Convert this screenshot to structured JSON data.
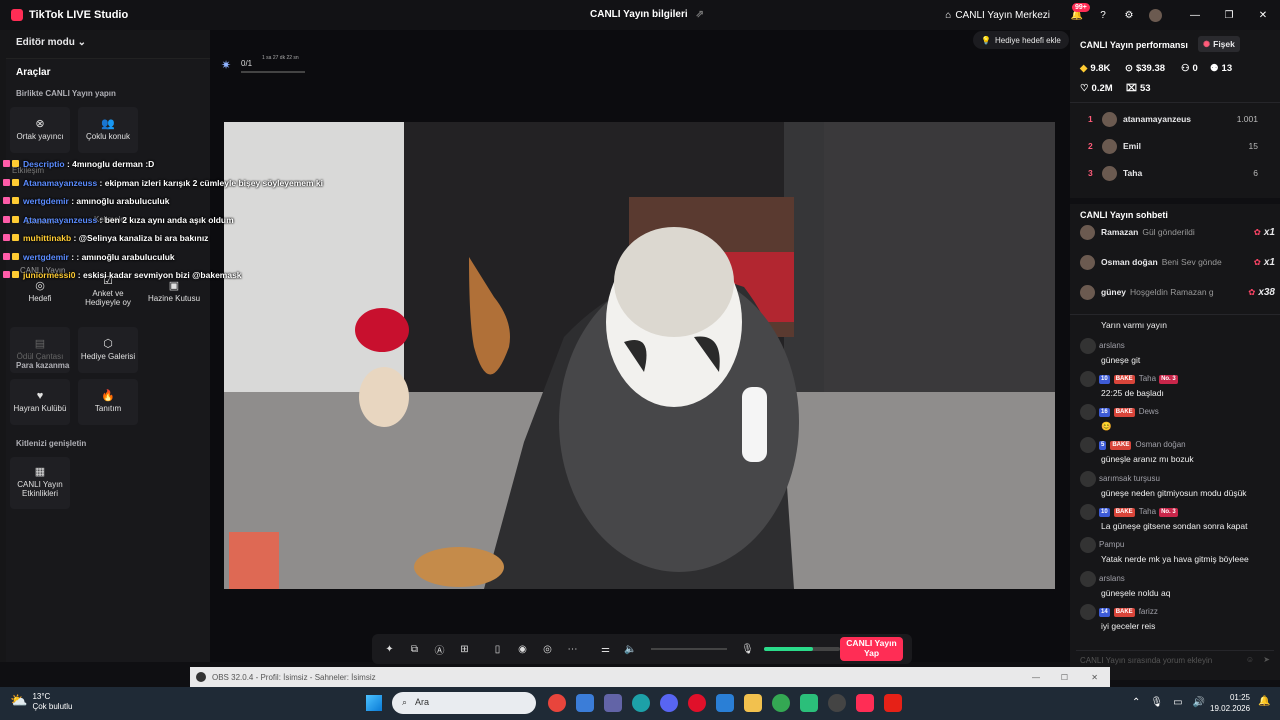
{
  "titlebar": {
    "app_title": "TikTok LIVE Studio",
    "center_title": "CANLI Yayın bilgileri",
    "live_center": "CANLI Yayın Merkezi",
    "notif_badge": "99+"
  },
  "left": {
    "mode": "Editör modu",
    "tools_title": "Araçlar",
    "sec_together": "Birlikte CANLI Yayın yapın",
    "tool_cohost": "Ortak yayıncı",
    "tool_multiguest": "Çoklu konuk",
    "hidden_etkilesim": "Etkileşim",
    "hidden_dilekler": "Dilekleri",
    "hidden_kelimeler": "Kelimeler",
    "hidden_canli": "CANLI Yayın",
    "tool_goal": "Hedefi",
    "tool_poll": "Anket ve Hediyeyle oy",
    "tool_treasure": "Hazine Kutusu",
    "tool_award": "Ödül Çantası",
    "tool_gallery": "Hediye Galerisi",
    "sec_money": "Para kazanma",
    "tool_fanclub": "Hayran Kulübü",
    "tool_promote": "Tanıtım",
    "sec_expand": "Kitlenizi genişletin",
    "tool_events": "CANLI Yayın Etkinlikleri"
  },
  "overlay": [
    {
      "user": "Descriptio",
      "text": " : 4mınoglu derman :D",
      "color": "#5b8cff"
    },
    {
      "user": "Atanamayanzeuss",
      "text": " : ekipman izleri karışık 2 cümleyle bişey söyleyemem ki",
      "color": "#5b8cff"
    },
    {
      "user": "wertgdemir",
      "text": " : amınoğlu arabuluculuk",
      "color": "#5b8cff"
    },
    {
      "user": "Atanamayanzeuss",
      "text": " : ben 2 kıza aynı anda aşık oldum",
      "color": "#5b8cff"
    },
    {
      "user": "muhittinakb",
      "text": " : @Selinya kanaliza bi ara bakınız",
      "color": "#ffcc33"
    },
    {
      "user": "wertgdemir",
      "text": " : : amınoğlu arabuluculuk",
      "color": "#5b8cff"
    },
    {
      "user": "",
      "text": "",
      "color": "#fff"
    },
    {
      "user": "juniormessi0",
      "text": " : eskisi kadar sevmiyon bizi @bakemask",
      "color": "#ffcc33"
    }
  ],
  "stage": {
    "goal_button": "Hediye hedefi ekle",
    "progress_count": "0/1",
    "progress_time": "1 sa 27 dk 22 sn",
    "progress_fraction": 0.0
  },
  "controls": {
    "golive": "CANLI Yayın Yap",
    "mic_level": 0.65
  },
  "right": {
    "perf_title": "CANLI Yayın performansı",
    "fisek": "Fişek",
    "stats": {
      "diamonds": "9.8K",
      "money": "$39.38",
      "viewers": "0",
      "followers": "13",
      "likes": "0.2M",
      "gifts": "53"
    },
    "ranking": [
      {
        "rank": "1",
        "name": "atanamayanzeus",
        "score": "1.001"
      },
      {
        "rank": "2",
        "name": "Emil",
        "score": "15"
      },
      {
        "rank": "3",
        "name": "Taha",
        "score": "6"
      }
    ],
    "chat_title": "CANLI Yayın sohbeti",
    "gifts": [
      {
        "name": "Ramazan",
        "text": "Gül gönderildi",
        "count": "x1"
      },
      {
        "name": "Osman doğan",
        "text": "Beni Sev gönde",
        "count": "x1"
      },
      {
        "name": "güney",
        "text": "Hoşgeldin Ramazan g",
        "count": "x38"
      }
    ],
    "messages": [
      {
        "user": "",
        "level": "",
        "tag": "",
        "extra": "",
        "text": "Yarın varmı yayın"
      },
      {
        "user": "arslans",
        "level": "",
        "tag": "",
        "extra": "",
        "text": "güneşe git"
      },
      {
        "user": "Taha",
        "level": "10",
        "tag": "BAKE",
        "extra": "No. 3",
        "text": "22:25 de başladı"
      },
      {
        "user": "Dews",
        "level": "16",
        "tag": "BAKE",
        "extra": "",
        "text": "😊"
      },
      {
        "user": "Osman doğan",
        "level": "5",
        "tag": "BAKE",
        "extra": "",
        "text": "güneşle aranız mı bozuk"
      },
      {
        "user": "sarımsak turşusu",
        "level": "",
        "tag": "",
        "extra": "",
        "text": "güneşe neden gitmiyosun modu düşük"
      },
      {
        "user": "Taha",
        "level": "10",
        "tag": "BAKE",
        "extra": "No. 3",
        "text": "La güneşe gitsene sondan sonra kapat"
      },
      {
        "user": "Pampu",
        "level": "",
        "tag": "",
        "extra": "",
        "text": "Yatak nerde mk ya hava gitmiş böyleee"
      },
      {
        "user": "arslans",
        "level": "",
        "tag": "",
        "extra": "",
        "text": "güneşele noldu aq"
      },
      {
        "user": "farizz",
        "level": "14",
        "tag": "BAKE",
        "extra": "",
        "text": "iyi geceler reis"
      }
    ],
    "comment_placeholder": "CANLI Yayın sırasında yorum ekleyin"
  },
  "obs": {
    "title": "OBS 32.0.4 - Profil: İsimsiz - Sahneler: İsimsiz"
  },
  "taskbar": {
    "temp": "13°C",
    "weather": "Çok bulutlu",
    "search": "Ara",
    "time": "01:25",
    "date": "19.02.2026"
  },
  "colors": {
    "accent": "#ff2d55",
    "panel": "#161618",
    "taskbar": "#1f2a36"
  }
}
